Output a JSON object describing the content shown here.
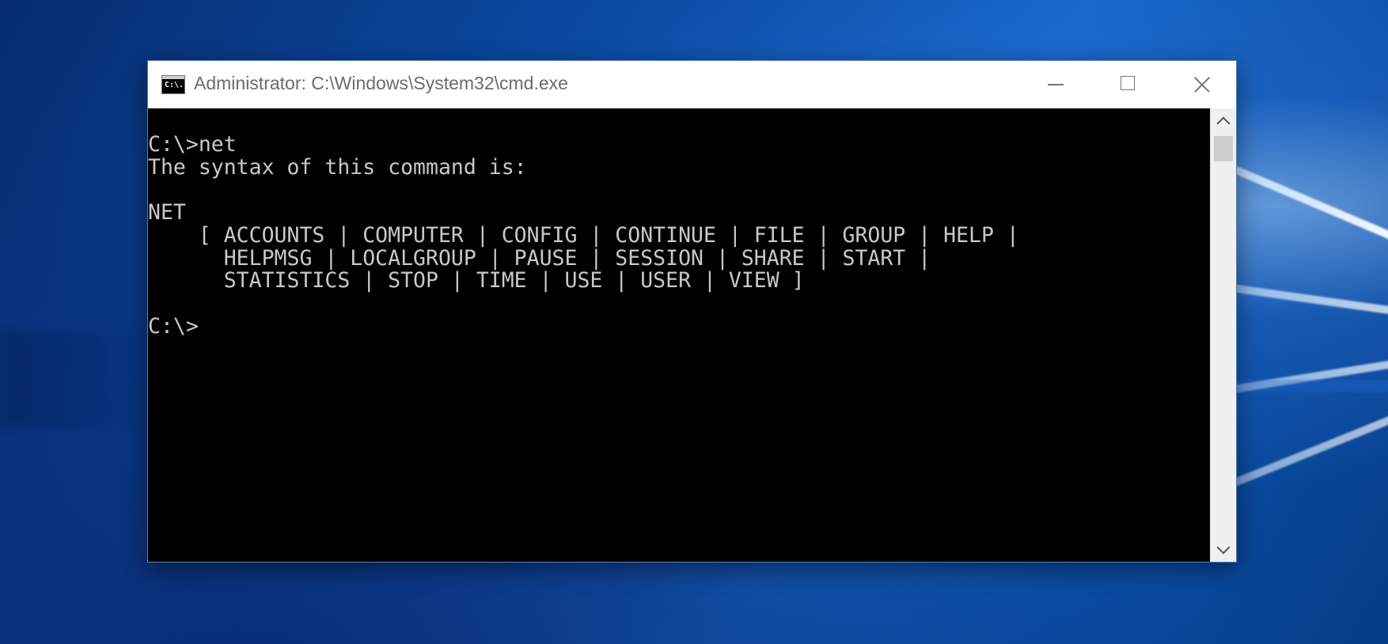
{
  "window": {
    "title": "Administrator: C:\\Windows\\System32\\cmd.exe",
    "icon_text": "C:\\.",
    "icon": "cmd-icon",
    "controls": {
      "minimize_icon": "minimize-icon",
      "maximize_icon": "maximize-icon",
      "close_icon": "close-icon"
    }
  },
  "console": {
    "lines": [
      "C:\\>net",
      "The syntax of this command is:",
      "",
      "NET",
      "    [ ACCOUNTS | COMPUTER | CONFIG | CONTINUE | FILE | GROUP | HELP |",
      "      HELPMSG | LOCALGROUP | PAUSE | SESSION | SHARE | START |",
      "      STATISTICS | STOP | TIME | USE | USER | VIEW ]",
      "",
      "C:\\>"
    ],
    "text_color": "#c8c8c8",
    "background_color": "#000000"
  },
  "scrollbar": {
    "up_icon": "chevron-up-icon",
    "down_icon": "chevron-down-icon"
  }
}
